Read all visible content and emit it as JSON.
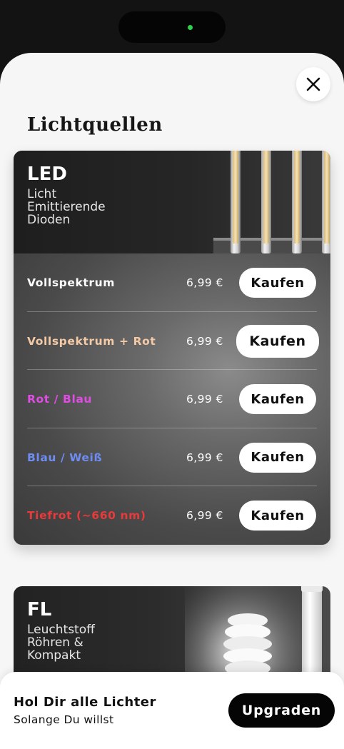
{
  "sheet": {
    "title": "Lichtquellen",
    "close_icon": "close-icon"
  },
  "led_card": {
    "name": "LED",
    "subtitle_lines": [
      "Licht",
      "Emittierende",
      "Dioden"
    ],
    "rows": [
      {
        "label": "Vollspektrum",
        "label_color": "#ffffff",
        "price": "6,99 €",
        "button": "Kaufen"
      },
      {
        "label": "Vollspektrum + Rot",
        "label_color": "#f4c9a6",
        "price": "6,99 €",
        "button": "Kaufen"
      },
      {
        "label": "Rot / Blau",
        "label_color": "#e04de2",
        "price": "6,99 €",
        "button": "Kaufen"
      },
      {
        "label": "Blau / Weiß",
        "label_color": "#6f8cf2",
        "price": "6,99 €",
        "button": "Kaufen"
      },
      {
        "label": "Tiefrot (~660 nm)",
        "label_color": "#e83a3a",
        "price": "6,99 €",
        "button": "Kaufen"
      }
    ]
  },
  "fl_card": {
    "name": "FL",
    "subtitle_lines": [
      "Leuchtstoff",
      "Röhren &",
      "Kompakt"
    ]
  },
  "promo": {
    "title": "Hol Dir alle Lichter",
    "subtitle": "Solange Du willst",
    "button": "Upgraden"
  }
}
